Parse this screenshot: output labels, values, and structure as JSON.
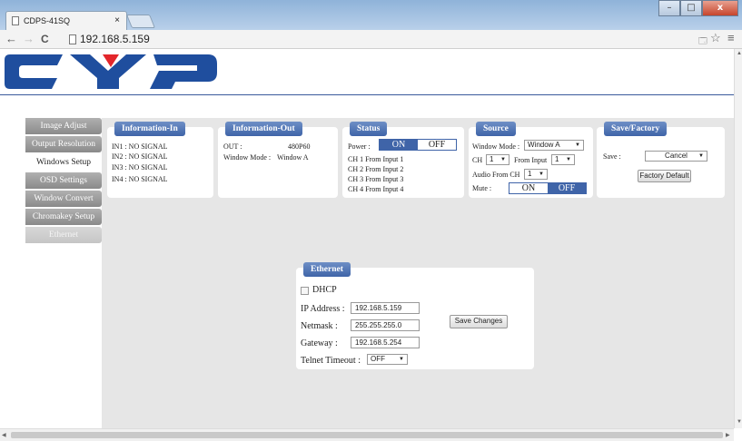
{
  "browser": {
    "tab_title": "CDPS-41SQ",
    "tab_close": "×",
    "url": "192.168.5.159",
    "nav_back": "←",
    "nav_forward": "→",
    "nav_reload": "C",
    "star": "☆",
    "menu": "≡",
    "translate": "🗔",
    "win_minimize": "–",
    "win_maximize": "□",
    "win_close": "x"
  },
  "logo": {
    "text": "CYP",
    "colors": {
      "blue": "#1f4e9e",
      "red": "#e3262b"
    }
  },
  "sidebar": {
    "items": [
      {
        "label": "Image Adjust"
      },
      {
        "label": "Output Resolution"
      },
      {
        "label": "Windows Setup"
      },
      {
        "label": "OSD Settings"
      },
      {
        "label": "Window Convert"
      },
      {
        "label": "Chromakey Setup"
      },
      {
        "label": "Ethernet"
      }
    ]
  },
  "info_in": {
    "title": "Information-In",
    "lines": [
      "IN1 : NO SIGNAL",
      "IN2 : NO SIGNAL",
      "IN3 : NO SIGNAL",
      "IN4 : NO SIGNAL"
    ]
  },
  "info_out": {
    "title": "Information-Out",
    "out_label": "OUT :",
    "out_value": "480P60",
    "mode_label": "Window Mode :",
    "mode_value": "Window A"
  },
  "status": {
    "title": "Status",
    "power_label": "Power :",
    "on": "ON",
    "off": "OFF",
    "channels": [
      "CH 1 From Input  1",
      "CH 2 From Input  2",
      "CH 3 From Input  3",
      "CH 4 From Input  4"
    ]
  },
  "source": {
    "title": "Source",
    "window_mode_label": "Window Mode :",
    "window_mode_value": "Window A",
    "ch_label": "CH",
    "ch_value": "1",
    "from_input_label": "From Input",
    "from_input_value": "1",
    "audio_label": "Audio From CH",
    "audio_value": "1",
    "mute_label": "Mute :",
    "on": "ON",
    "off": "OFF"
  },
  "save_factory": {
    "title": "Save/Factory",
    "save_label": "Save :",
    "save_value": "Cancel",
    "factory_button": "Factory Default"
  },
  "ethernet": {
    "title": "Ethernet",
    "dhcp_label": "DHCP",
    "ip_label": "IP Address :",
    "ip_value": "192.168.5.159",
    "netmask_label": "Netmask :",
    "netmask_value": "255.255.255.0",
    "gateway_label": "Gateway :",
    "gateway_value": "192.168.5.254",
    "telnet_label": "Telnet Timeout :",
    "telnet_value": "OFF",
    "save_button": "Save Changes"
  },
  "caret": "▼"
}
